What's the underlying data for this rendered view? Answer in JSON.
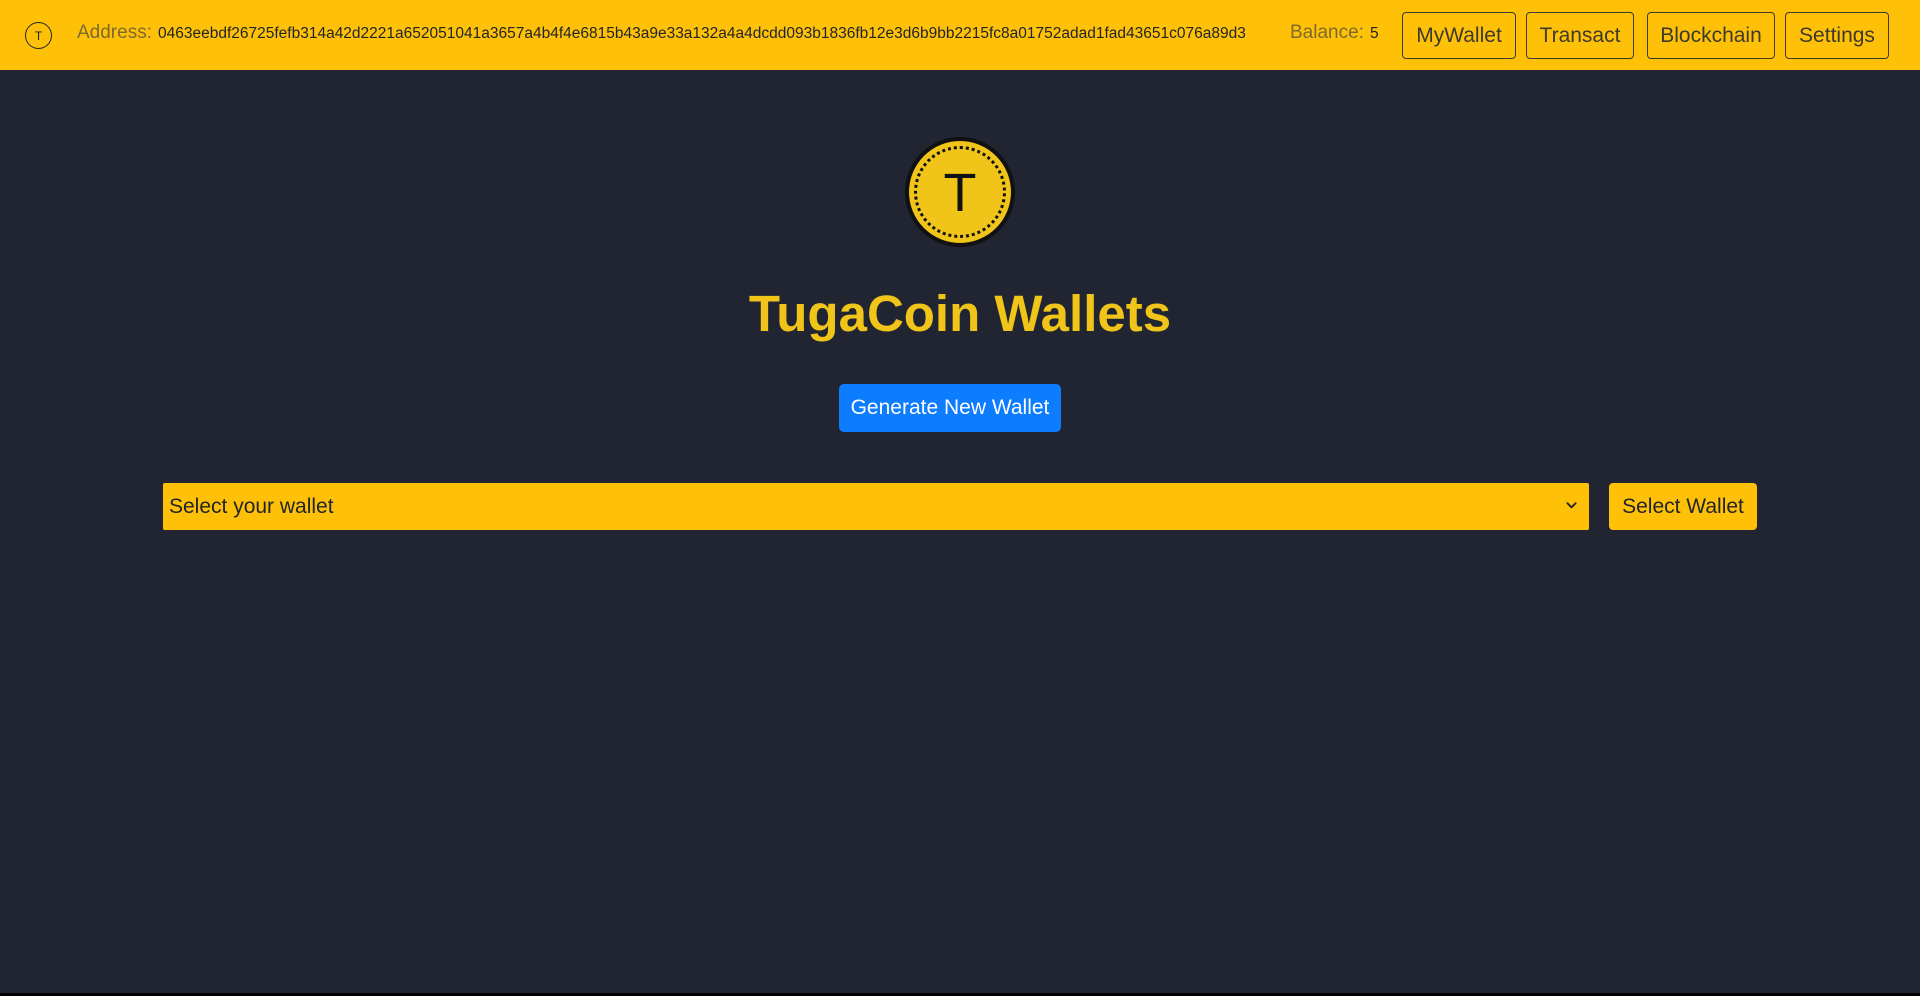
{
  "nav": {
    "logo_letter": "T",
    "address_label": "Address:",
    "address_value": "0463eebdf26725fefb314a42d2221a652051041a3657a4b4f4e6815b43a9e33a132a4a4dcdd093b1836fb12e3d6b9bb2215fc8a01752adad1fad43651c076a89d3",
    "balance_label": "Balance:",
    "balance_value": "5",
    "buttons": [
      "MyWallet",
      "Transact",
      "Blockchain",
      "Settings"
    ]
  },
  "main": {
    "coin_letter": "T",
    "title": "TugaCoin Wallets",
    "generate_label": "Generate New Wallet",
    "wallet_select_value": "Select your wallet",
    "select_wallet_label": "Select Wallet"
  },
  "colors": {
    "navbar": "#ffc107",
    "background": "#212532",
    "accent_text": "#f0c419",
    "primary_button": "#0d7cff"
  },
  "icons": {
    "nav_logo": "coin-logo-icon",
    "coin": "coin-icon",
    "dropdown": "chevron-down-icon"
  }
}
